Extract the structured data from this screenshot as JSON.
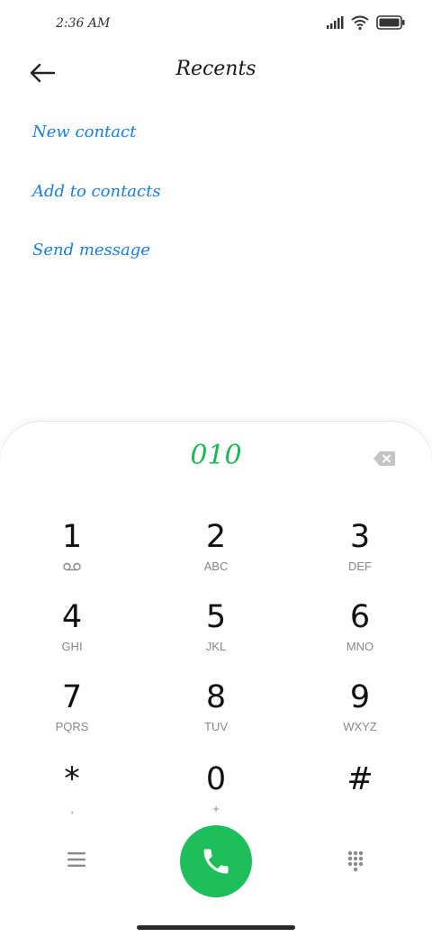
{
  "status_bar": {
    "time": "2:36 AM"
  },
  "header": {
    "title": "Recents"
  },
  "options": {
    "new_contact": "New contact",
    "add_to_contacts": "Add to contacts",
    "send_message": "Send message"
  },
  "dialer": {
    "number": "010",
    "keys": [
      {
        "digit": "1",
        "letters": ""
      },
      {
        "digit": "2",
        "letters": "ABC"
      },
      {
        "digit": "3",
        "letters": "DEF"
      },
      {
        "digit": "4",
        "letters": "GHI"
      },
      {
        "digit": "5",
        "letters": "JKL"
      },
      {
        "digit": "6",
        "letters": "MNO"
      },
      {
        "digit": "7",
        "letters": "PQRS"
      },
      {
        "digit": "8",
        "letters": "TUV"
      },
      {
        "digit": "9",
        "letters": "WXYZ"
      },
      {
        "digit": "*",
        "letters": ","
      },
      {
        "digit": "0",
        "letters": "+"
      },
      {
        "digit": "#",
        "letters": ""
      }
    ]
  },
  "colors": {
    "accent_blue": "#1a7fe0",
    "number_green": "#1db954",
    "call_green": "#1fbe5c"
  }
}
